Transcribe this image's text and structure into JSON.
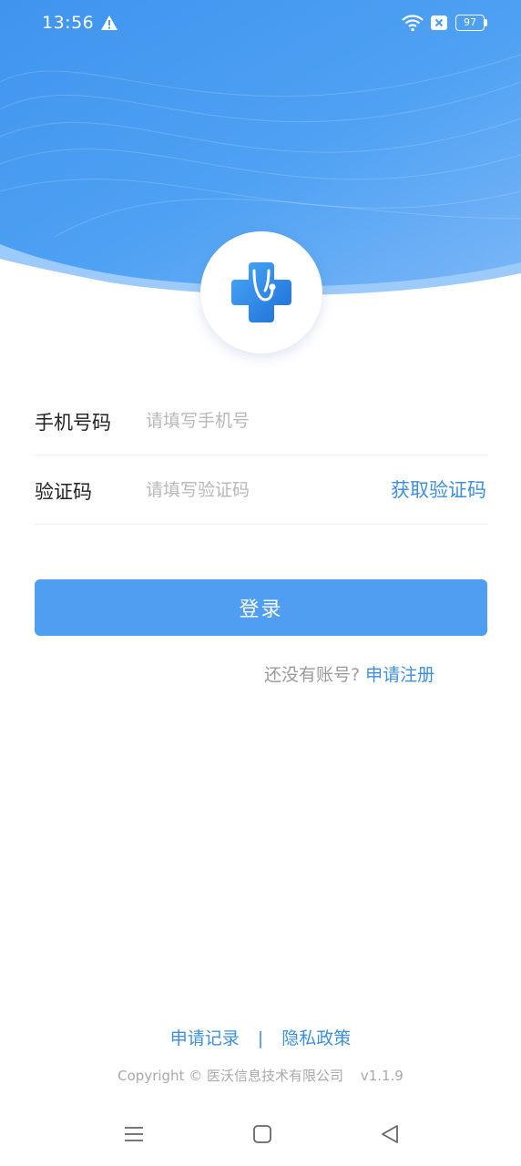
{
  "status_bar": {
    "time": "13:56",
    "battery_level": "97",
    "icons": [
      "warning-icon",
      "wifi-icon",
      "sim-no-signal-icon",
      "battery-icon"
    ]
  },
  "logo": {
    "icon": "medical-cross-stethoscope-icon"
  },
  "form": {
    "phone_label": "手机号码",
    "phone_placeholder": "请填写手机号",
    "phone_value": "",
    "code_label": "验证码",
    "code_placeholder": "请填写验证码",
    "code_value": "",
    "get_code_label": "获取验证码"
  },
  "login_button": "登录",
  "register": {
    "prompt": "还没有账号?",
    "link": "申请注册"
  },
  "footer": {
    "apply_record": "申请记录",
    "separator": "|",
    "privacy_policy": "隐私政策",
    "copyright": "Copyright © 医沃信息技术有限公司",
    "version": "v1.1.9"
  },
  "nav_bar": {
    "icons": [
      "menu-icon",
      "home-icon",
      "back-icon"
    ]
  },
  "colors": {
    "header_gradient_start": "#3f94ee",
    "header_gradient_end": "#8fc3f9",
    "accent": "#3d8fe0",
    "button": "#4f9ef1",
    "placeholder": "#b8b8b8"
  }
}
